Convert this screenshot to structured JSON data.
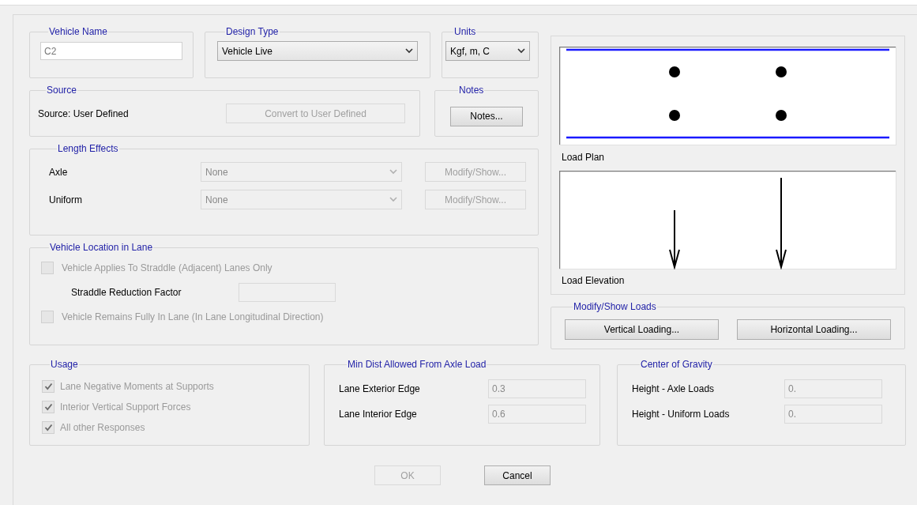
{
  "vehicle_name": {
    "label": "Vehicle Name",
    "value": "C2"
  },
  "design_type": {
    "label": "Design Type",
    "value": "Vehicle Live"
  },
  "units": {
    "label": "Units",
    "value": "Kgf, m, C"
  },
  "source": {
    "label": "Source",
    "text": "Source: User Defined",
    "button": {
      "label": "Convert to User Defined",
      "disabled": true
    }
  },
  "notes": {
    "label": "Notes",
    "button": {
      "label": "Notes...",
      "disabled": false
    }
  },
  "length_effects": {
    "label": "Length Effects",
    "rows": [
      {
        "label": "Axle",
        "value": "None",
        "button": "Modify/Show...",
        "disabled": true
      },
      {
        "label": "Uniform",
        "value": "None",
        "button": "Modify/Show...",
        "disabled": true
      }
    ]
  },
  "vehicle_location": {
    "label": "Vehicle Location in Lane",
    "options": [
      {
        "kind": "checkbox",
        "label": "Vehicle Applies To Straddle (Adjacent) Lanes Only",
        "checked": false,
        "disabled": true
      },
      {
        "kind": "field",
        "label": "Straddle Reduction Factor",
        "disabled": true
      },
      {
        "kind": "checkbox",
        "label": "Vehicle Remains Fully In Lane (In Lane Longitudinal Direction)",
        "checked": false,
        "disabled": true
      }
    ]
  },
  "preview": {
    "plan_label": "Load Plan",
    "elevation_label": "Load Elevation"
  },
  "modify_show_loads": {
    "label": "Modify/Show Loads",
    "buttons": [
      {
        "label": "Vertical Loading...",
        "disabled": false
      },
      {
        "label": "Horizontal Loading...",
        "disabled": false
      }
    ]
  },
  "usage": {
    "label": "Usage",
    "items": [
      {
        "label": "Lane Negative Moments at Supports",
        "checked": true,
        "disabled": true
      },
      {
        "label": "Interior Vertical Support Forces",
        "checked": true,
        "disabled": true
      },
      {
        "label": "All other Responses",
        "checked": true,
        "disabled": true
      }
    ]
  },
  "min_dist": {
    "label": "Min Dist Allowed From Axle Load",
    "fields": [
      {
        "label": "Lane Exterior Edge",
        "value": "0.3",
        "disabled": true
      },
      {
        "label": "Lane Interior Edge",
        "value": "0.6",
        "disabled": true
      }
    ]
  },
  "center_of_gravity": {
    "label": "Center of Gravity",
    "fields": [
      {
        "label": "Height - Axle Loads",
        "value": "0.",
        "disabled": true
      },
      {
        "label": "Height - Uniform Loads",
        "value": "0.",
        "disabled": true
      }
    ]
  },
  "buttons": [
    {
      "label": "OK",
      "disabled": true
    },
    {
      "label": "Cancel",
      "disabled": false
    }
  ]
}
